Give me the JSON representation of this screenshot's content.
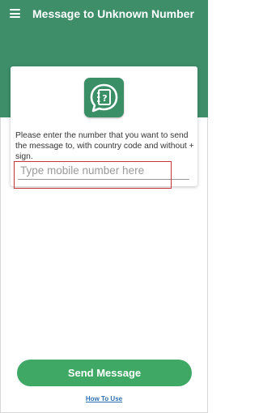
{
  "app_bar": {
    "title": "Message to Unknown Number",
    "menu_icon": "menu-icon"
  },
  "card": {
    "app_icon": "chat-note-icon",
    "instruction": "Please enter the number that you want to send the message to, with country code and without + sign.",
    "phone_input": {
      "value": "",
      "placeholder": "Type mobile number here"
    }
  },
  "actions": {
    "send_label": "Send Message",
    "how_to_use_label": "How To Use"
  },
  "colors": {
    "primary": "#3e8e6a",
    "button": "#3fa865",
    "link": "#2d6fb3",
    "highlight": "#c9343a"
  }
}
